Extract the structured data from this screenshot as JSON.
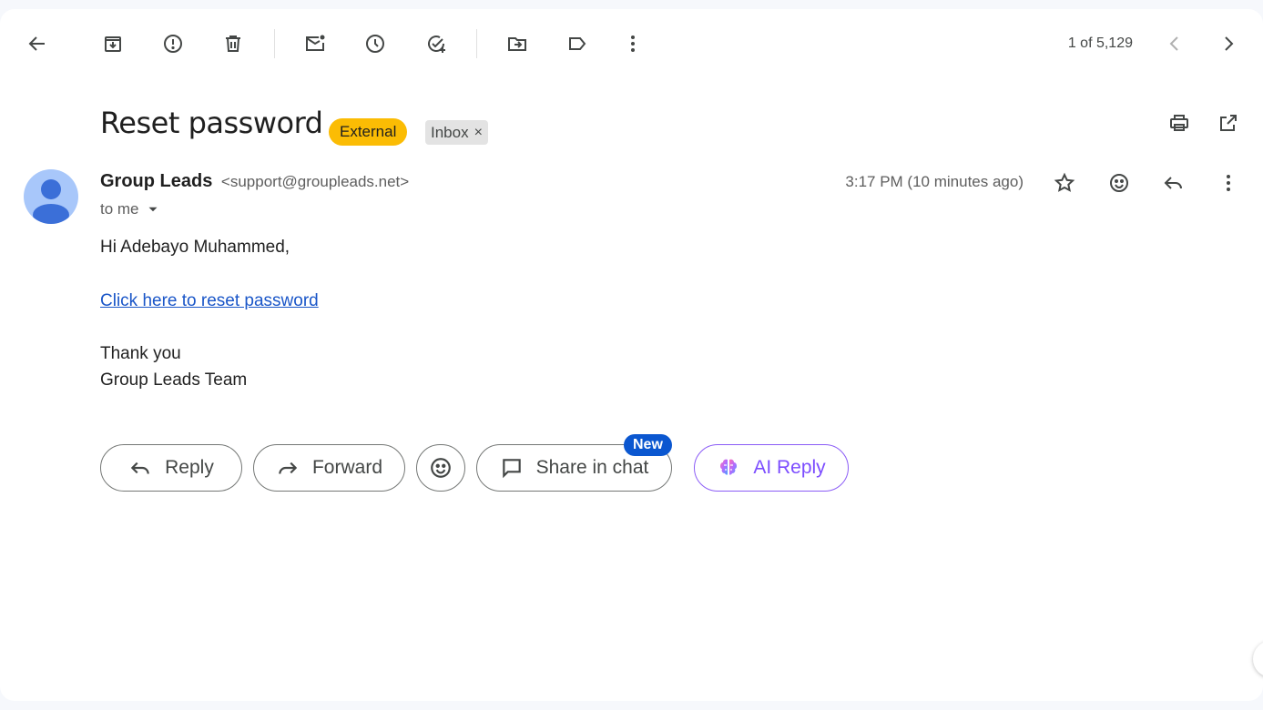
{
  "toolbar": {
    "back": "back-arrow-icon",
    "archive": "archive-icon",
    "report_spam": "report-spam-icon",
    "delete": "trash-icon",
    "mark_unread": "mark-unread-icon",
    "snooze": "snooze-clock-icon",
    "add_task": "add-task-icon",
    "move_to": "move-to-icon",
    "label": "label-icon",
    "more": "more-vertical-icon"
  },
  "pager": {
    "text": "1 of 5,129"
  },
  "email": {
    "subject": "Reset password",
    "labels": {
      "external": "External",
      "inbox": "Inbox",
      "inbox_remove": "×"
    },
    "sender_name": "Group Leads",
    "sender_email": "<support@groupleads.net>",
    "recipient": "to me",
    "timestamp": "3:17 PM (10 minutes ago)",
    "greeting": "Hi Adebayo Muhammed,",
    "link_text": "Click here to reset password",
    "closing_1": "Thank you",
    "closing_2": "Group Leads Team"
  },
  "actions": {
    "reply": "Reply",
    "forward": "Forward",
    "share_in_chat": "Share in chat",
    "new_badge": "New",
    "ai_reply": "AI Reply"
  },
  "colors": {
    "external_chip": "#fbbc04",
    "link": "#1a56c8",
    "new_badge": "#0b57d0",
    "ai_accent": "#7c4dff"
  }
}
